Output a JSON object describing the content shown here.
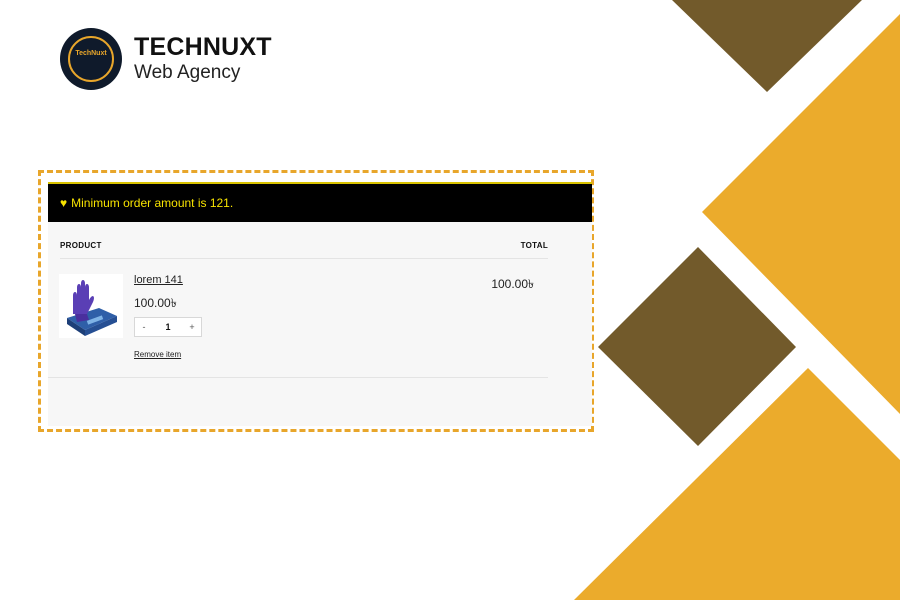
{
  "brand": {
    "name": "TECHNUXT",
    "tagline": "Web Agency",
    "logo_text": "TechNuxt",
    "accent_color": "#e8a62b"
  },
  "decoration": {
    "dark_color": "#725a2b",
    "gold_color": "#ebab2c"
  },
  "cart": {
    "notice": {
      "icon": "heart-icon",
      "text": "Minimum order amount is 121."
    },
    "columns": {
      "product": "PRODUCT",
      "total": "TOTAL"
    },
    "items": [
      {
        "name": "lorem 141",
        "price": "100.00৳",
        "quantity": "1",
        "decrease_label": "-",
        "increase_label": "+",
        "remove_label": "Remove item",
        "total": "100.00৳",
        "image": "gloves-box-image"
      }
    ]
  }
}
